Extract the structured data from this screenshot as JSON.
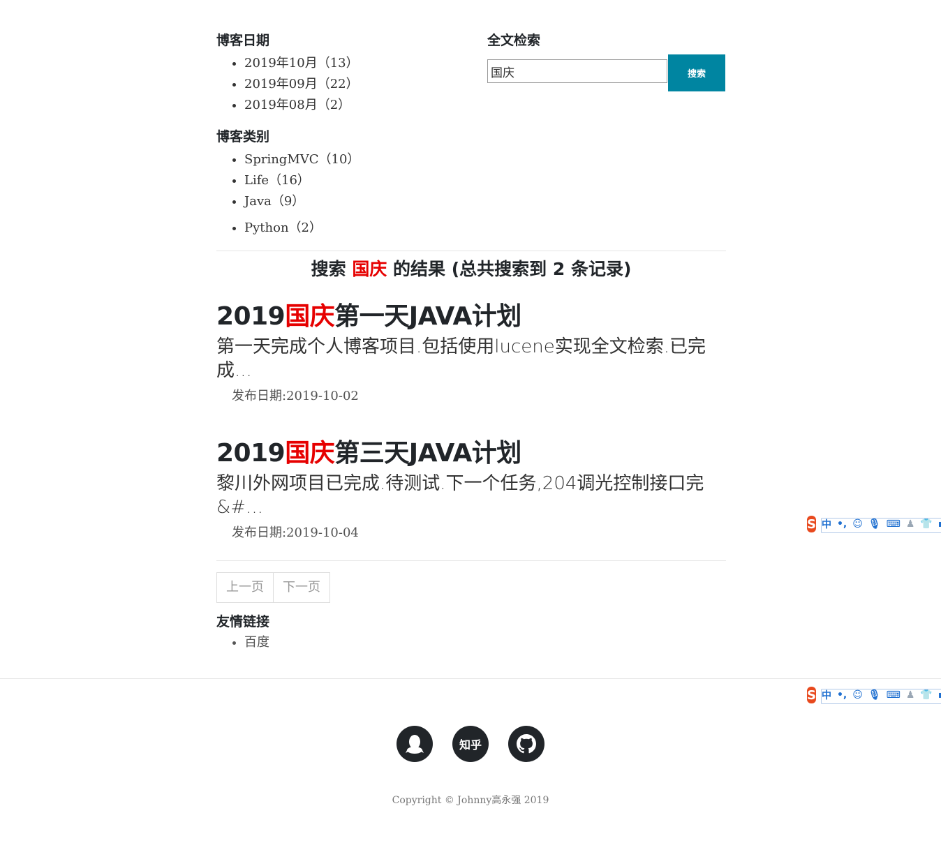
{
  "sidebar": {
    "dates_title": "博客日期",
    "dates": [
      "2019年10月（13）",
      "2019年09月（22）",
      "2019年08月（2）"
    ],
    "categories_title": "博客类别",
    "categories": [
      "SpringMVC（10）",
      "Life（16）",
      "Java（9）",
      "Python（2）"
    ]
  },
  "search": {
    "title": "全文检索",
    "value": "国庆",
    "button_label": "搜索"
  },
  "results": {
    "prefix": "搜索",
    "keyword": "国庆",
    "suffix": "的结果 (总共搜索到 2 条记录)"
  },
  "posts": [
    {
      "title_before": "2019",
      "title_keyword": "国庆",
      "title_after": "第一天JAVA计划",
      "summary": "第一天完成个人博客项目.包括使用lucene实现全文检索.已完成...",
      "date": "发布日期:2019-10-02"
    },
    {
      "title_before": "2019",
      "title_keyword": "国庆",
      "title_after": "第三天JAVA计划",
      "summary": "黎川外网项目已完成.待测试.下一个任务,204调光控制接口完&#...",
      "date": "发布日期:2019-10-04"
    }
  ],
  "pager": {
    "prev": "上一页",
    "next": "下一页"
  },
  "links": {
    "title": "友情链接",
    "items": [
      "百度"
    ]
  },
  "footer": {
    "social_zhihu": "知乎",
    "copyright": "Copyright © Johnny高永强 2019"
  },
  "ime": {
    "logo": "S",
    "mode": "中"
  },
  "colors": {
    "accent": "#0085a1",
    "keyword": "#e60000"
  }
}
